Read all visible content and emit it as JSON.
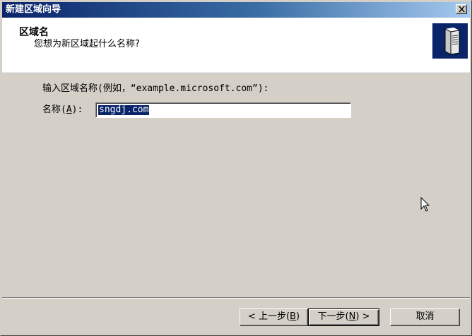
{
  "window": {
    "title": "新建区域向导"
  },
  "header": {
    "title": "区域名",
    "subtitle": "您想为新区域起什么名称?",
    "icon": "server-icon"
  },
  "form": {
    "prompt": "输入区域名称(例如，“example.microsoft.com”):",
    "name_label_pre": "名称(",
    "name_label_key": "A",
    "name_label_post": "):",
    "name_value": "sngdj.com"
  },
  "buttons": {
    "back_label_pre": "< 上一步(",
    "back_label_key": "B",
    "back_label_post": ")",
    "next_label_pre": "下一步(",
    "next_label_key": "N",
    "next_label_post": ") >",
    "cancel_label": "取消"
  },
  "colors": {
    "titlebar_start": "#0a246a",
    "titlebar_end": "#a6caf0",
    "face": "#d4d0c8",
    "selection": "#0a246a"
  }
}
